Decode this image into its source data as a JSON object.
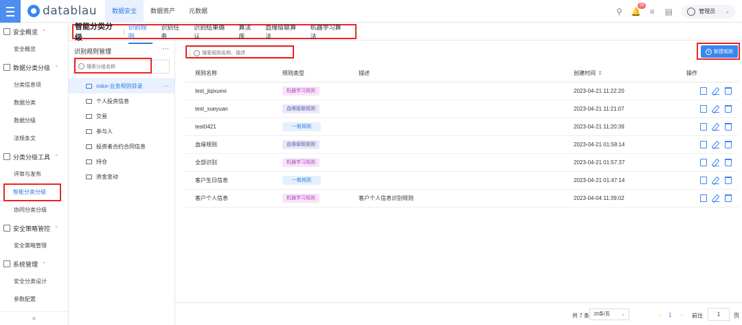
{
  "app": {
    "logo_text": "datablau"
  },
  "topnav": [
    {
      "label": "数据安全",
      "active": true
    },
    {
      "label": "数据资产",
      "active": false
    },
    {
      "label": "元数据",
      "active": false
    }
  ],
  "topright": {
    "notification_count": "26",
    "user_name": "管理员"
  },
  "sidebar": {
    "groups": [
      {
        "label": "安全概览",
        "items": [
          {
            "label": "安全概览"
          }
        ]
      },
      {
        "label": "数据分类分级",
        "items": [
          {
            "label": "分类信息项"
          },
          {
            "label": "数据分类"
          },
          {
            "label": "数据分级"
          },
          {
            "label": "法规条文"
          }
        ]
      },
      {
        "label": "分类分级工具",
        "items": [
          {
            "label": "评审与发布"
          },
          {
            "label": "智能分类分级"
          },
          {
            "label": "协同分类分级"
          }
        ]
      },
      {
        "label": "安全策略管控",
        "items": [
          {
            "label": "安全策略管理"
          }
        ]
      },
      {
        "label": "系统管理",
        "items": [
          {
            "label": "安全分类设计"
          },
          {
            "label": "参数配置"
          }
        ]
      }
    ],
    "collapse_icon": "«"
  },
  "tabs": {
    "title": "智能分类分级",
    "items": [
      "识别规则",
      "识别任务",
      "识别结果确认",
      "算法库",
      "血缘级联算法",
      "机器学习算法"
    ]
  },
  "tree": {
    "title": "识别规则管理",
    "search_placeholder": "搜索分组名称",
    "nodes": [
      "mike-业务规则目录",
      "个人投资信息",
      "交易",
      "参与人",
      "投资者合约合同信息",
      "持仓",
      "资金变动"
    ]
  },
  "main": {
    "search_placeholder": "搜索规则名称、描述",
    "new_button": "新建规则",
    "columns": {
      "name": "规则名称",
      "type": "规则类型",
      "desc": "描述",
      "time": "创建时间",
      "ops": "操作"
    },
    "rows": [
      {
        "name": "test_jiqixuexi",
        "type": "机器学习规则",
        "type_style": "ml",
        "desc": "",
        "time": "2023-04-21 11:22:20"
      },
      {
        "name": "test_xueyuan",
        "type": "血缘级联规则",
        "type_style": "bl",
        "desc": "",
        "time": "2023-04-21 11:21:07"
      },
      {
        "name": "test0421",
        "type": "一般规则",
        "type_style": "gn",
        "desc": "",
        "time": "2023-04-21 11:20:39"
      },
      {
        "name": "血缘规则",
        "type": "血缘级联规则",
        "type_style": "bl",
        "desc": "",
        "time": "2023-04-21 01:58:14"
      },
      {
        "name": "全部识别",
        "type": "机器学习规则",
        "type_style": "ml",
        "desc": "",
        "time": "2023-04-21 01:57:37"
      },
      {
        "name": "客户生日信息",
        "type": "一般规则",
        "type_style": "gn",
        "desc": "",
        "time": "2023-04-21 01:47:14"
      },
      {
        "name": "客户个人信息",
        "type": "机器学习规则",
        "type_style": "ml",
        "desc": "客户个人信息识别规则",
        "time": "2023-04-04 11:39:02"
      }
    ]
  },
  "pager": {
    "total": "共 7 条",
    "page_size": "20条/页",
    "current_page": "1",
    "goto_label": "前往",
    "goto_value": "1",
    "page_suffix": "页"
  }
}
